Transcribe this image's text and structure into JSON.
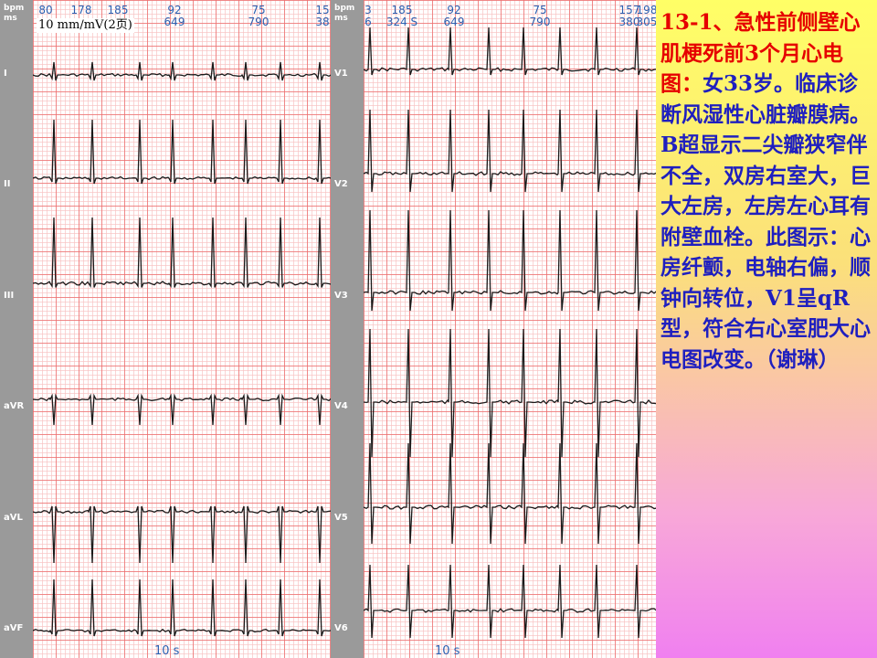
{
  "left_strip": {
    "unit_bpm": "bpm",
    "unit_ms": "ms",
    "leads": [
      "I",
      "II",
      "III",
      "aVR",
      "aVL",
      "aVF"
    ]
  },
  "right_strip": {
    "unit_bpm": "bpm",
    "unit_ms": "ms",
    "leads": [
      "V1",
      "V2",
      "V3",
      "V4",
      "V5",
      "V6"
    ]
  },
  "left_header": [
    {
      "bpm": "80",
      "ms": ""
    },
    {
      "bpm": "178",
      "ms": ""
    },
    {
      "bpm": "185",
      "ms": ""
    },
    {
      "bpm": "92",
      "ms": "649"
    },
    {
      "bpm": "75",
      "ms": "790"
    },
    {
      "bpm": "15",
      "ms": "38"
    }
  ],
  "right_header": [
    {
      "bpm": "3",
      "ms": "6"
    },
    {
      "bpm": "185",
      "ms": "324 S"
    },
    {
      "bpm": "92",
      "ms": "649"
    },
    {
      "bpm": "75",
      "ms": "790"
    },
    {
      "bpm": "157",
      "ms": "380"
    },
    {
      "bpm": "198",
      "ms": "305"
    }
  ],
  "calibration_label": "10 mm/mV(2页)",
  "time_label_left": "10 s",
  "time_label_right": "10 s",
  "description": {
    "title": "13-1、急性前侧壁心肌梗死前3个月心电图：",
    "body": "女33岁。临床诊断风湿性心脏瓣膜病。B超显示二尖瓣狭窄伴不全，双房右室大，巨大左房，左房左心耳有附壁血栓。此图示：心房纤颤，电轴右偏，顺钟向转位，V1呈qR型，符合右心室肥大心电图改变。（谢琳）"
  },
  "colors": {
    "title_text": "#e60000",
    "body_text": "#1f1fbf",
    "trace": "#1a1a1a",
    "grid_major": "#ec6e6e",
    "grid_minor": "#f8c3c3",
    "label_strip": "#9a9a9a",
    "header_text": "#2b5fb0"
  }
}
